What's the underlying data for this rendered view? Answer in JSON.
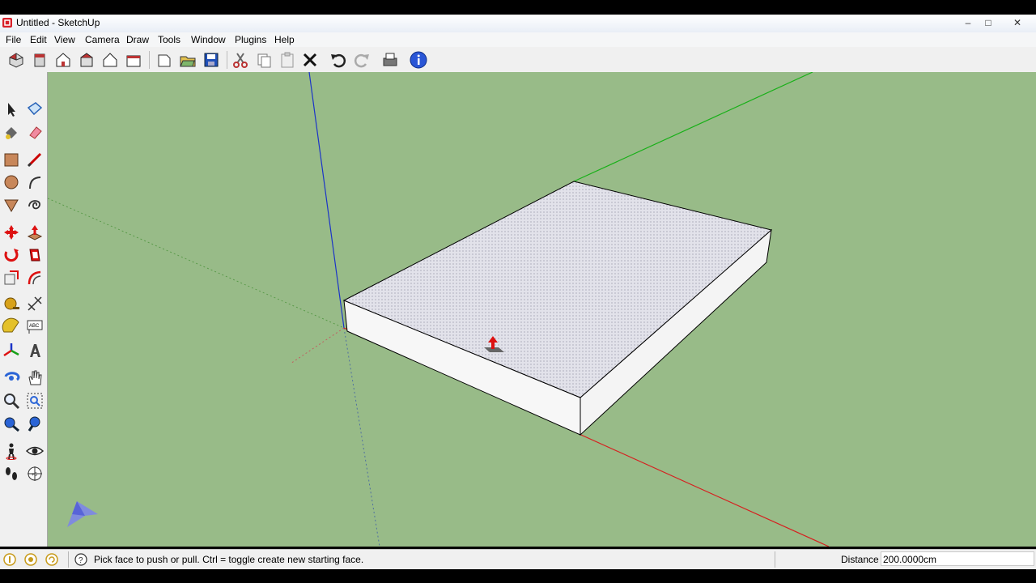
{
  "window": {
    "title": "Untitled - SketchUp",
    "controls": {
      "minimize": "–",
      "maximize": "□",
      "close": "✕"
    }
  },
  "menubar": {
    "items": [
      "File",
      "Edit",
      "View",
      "Camera",
      "Draw",
      "Tools",
      "Window",
      "Plugins",
      "Help"
    ]
  },
  "toolbar": {
    "icons": [
      "iso-view-icon",
      "top-view-icon",
      "front-view-icon",
      "right-view-icon",
      "back-view-icon",
      "left-view-icon",
      "new-icon",
      "open-icon",
      "save-icon",
      "cut-icon",
      "copy-icon",
      "paste-icon",
      "erase-icon",
      "undo-icon",
      "redo-icon",
      "print-icon",
      "model-info-icon"
    ]
  },
  "left_toolbar": {
    "tools": [
      "select",
      "make-component",
      "paint-bucket",
      "eraser",
      "rectangle",
      "line",
      "circle",
      "arc",
      "polygon",
      "freehand",
      "move",
      "push-pull",
      "rotate",
      "follow-me",
      "scale",
      "offset",
      "tape-measure",
      "dimension",
      "protractor",
      "text",
      "axes",
      "3d-text",
      "orbit",
      "pan",
      "zoom",
      "zoom-window",
      "zoom-extents",
      "previous",
      "position-camera",
      "look-around",
      "walk",
      "section-plane"
    ]
  },
  "colors": {
    "viewport_bg": "#98bb88",
    "face_top": "#e2e2ea",
    "face_side": "#f7f7f7",
    "axis_red": "#d62020",
    "axis_green": "#18b018",
    "axis_blue": "#1b34c8",
    "edge": "#000000"
  },
  "statusbar": {
    "message": "Pick face to push or pull.  Ctrl = toggle create new starting face.",
    "vcb_label": "Distance",
    "vcb_value": "200.0000cm"
  }
}
